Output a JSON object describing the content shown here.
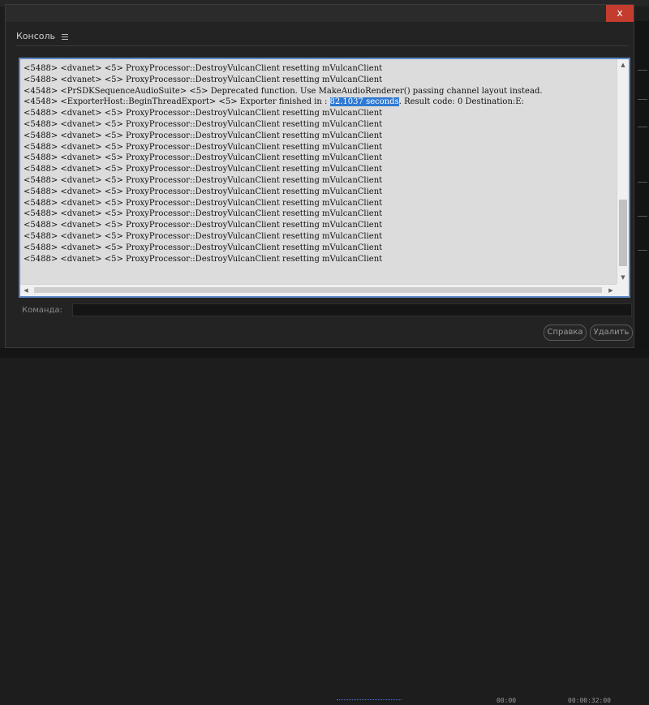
{
  "dialog": {
    "close_label": "x"
  },
  "panel": {
    "title": "Консоль",
    "menu_icon": "hamburger-menu-icon"
  },
  "console": {
    "lines": [
      "<5488> <dvanet> <5> ProxyProcessor::DestroyVulcanClient resetting mVulcanClient",
      "<5488> <dvanet> <5> ProxyProcessor::DestroyVulcanClient resetting mVulcanClient",
      "<4548> <PrSDKSequenceAudioSuite> <5> Deprecated function. Use MakeAudioRenderer() passing channel layout instead.",
      "<4548> <ExporterHost::BeginThreadExport> <5> Exporter finished in : 82.1037 seconds. Result code: 0 Destination:E:",
      "<5488> <dvanet> <5> ProxyProcessor::DestroyVulcanClient resetting mVulcanClient",
      "<5488> <dvanet> <5> ProxyProcessor::DestroyVulcanClient resetting mVulcanClient",
      "<5488> <dvanet> <5> ProxyProcessor::DestroyVulcanClient resetting mVulcanClient",
      "<5488> <dvanet> <5> ProxyProcessor::DestroyVulcanClient resetting mVulcanClient",
      "<5488> <dvanet> <5> ProxyProcessor::DestroyVulcanClient resetting mVulcanClient",
      "<5488> <dvanet> <5> ProxyProcessor::DestroyVulcanClient resetting mVulcanClient",
      "<5488> <dvanet> <5> ProxyProcessor::DestroyVulcanClient resetting mVulcanClient",
      "<5488> <dvanet> <5> ProxyProcessor::DestroyVulcanClient resetting mVulcanClient",
      "<5488> <dvanet> <5> ProxyProcessor::DestroyVulcanClient resetting mVulcanClient",
      "<5488> <dvanet> <5> ProxyProcessor::DestroyVulcanClient resetting mVulcanClient",
      "<5488> <dvanet> <5> ProxyProcessor::DestroyVulcanClient resetting mVulcanClient",
      "<5488> <dvanet> <5> ProxyProcessor::DestroyVulcanClient resetting mVulcanClient",
      "<5488> <dvanet> <5> ProxyProcessor::DestroyVulcanClient resetting mVulcanClient",
      "<5488> <dvanet> <5> ProxyProcessor::DestroyVulcanClient resetting mVulcanClient"
    ],
    "highlighted_line_index": 3,
    "highlighted_text": "82.1037 seconds",
    "highlight_color": "#3079d3",
    "border_color": "#5d88c4"
  },
  "command": {
    "label": "Команда:",
    "value": "",
    "placeholder": ""
  },
  "buttons": {
    "help": "Справка",
    "delete": "Удалить"
  },
  "background": {
    "timecode_left": "00:00",
    "timecode_right": "00:00:32:00"
  },
  "colors": {
    "close_button": "#c43c2d",
    "dialog_bg": "#232323",
    "console_bg": "#dcdcdc"
  }
}
